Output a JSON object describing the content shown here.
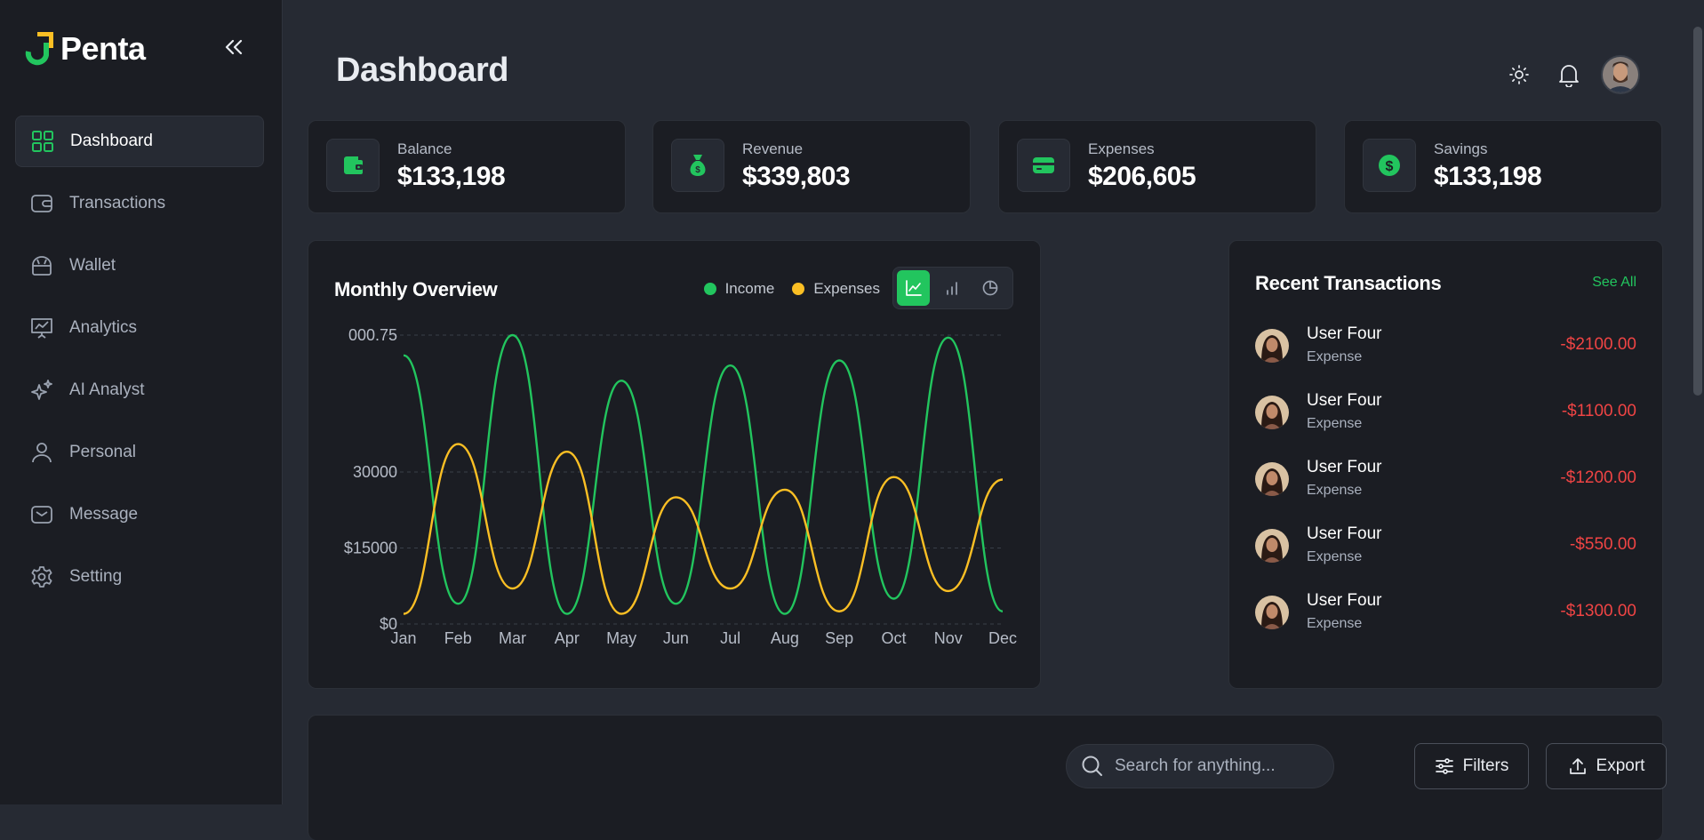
{
  "app": {
    "name": "Penta"
  },
  "colors": {
    "accent": "#22c55e",
    "income": "#22c55e",
    "expenses": "#fbbf24",
    "negative": "#ef4444",
    "background": "#262a33",
    "card": "#1b1d23"
  },
  "sidebar": {
    "collapse_icon": "double-chevron-left-icon",
    "items": [
      {
        "label": "Dashboard",
        "icon": "grid-icon",
        "active": true
      },
      {
        "label": "Transactions",
        "icon": "card-wallet-icon"
      },
      {
        "label": "Wallet",
        "icon": "wallet-bag-icon"
      },
      {
        "label": "Analytics",
        "icon": "presentation-chart-icon"
      },
      {
        "label": "AI Analyst",
        "icon": "sparkle-icon"
      },
      {
        "label": "Personal",
        "icon": "user-icon"
      },
      {
        "label": "Message",
        "icon": "mail-icon"
      },
      {
        "label": "Setting",
        "icon": "gear-icon"
      }
    ]
  },
  "header": {
    "title": "Dashboard",
    "icons": [
      "sun-icon",
      "bell-icon",
      "avatar"
    ]
  },
  "stats": [
    {
      "label": "Balance",
      "value": "$133,198",
      "icon": "wallet-icon"
    },
    {
      "label": "Revenue",
      "value": "$339,803",
      "icon": "money-bag-icon"
    },
    {
      "label": "Expenses",
      "value": "$206,605",
      "icon": "credit-card-icon"
    },
    {
      "label": "Savings",
      "value": "$133,198",
      "icon": "dollar-coin-icon"
    }
  ],
  "overview": {
    "title": "Monthly Overview",
    "legend": {
      "income": "Income",
      "expenses": "Expenses"
    },
    "chart_types": [
      "line-chart-icon",
      "bar-chart-icon",
      "pie-chart-icon"
    ],
    "active_chart_type": "line"
  },
  "chart_data": {
    "type": "line",
    "categories": [
      "Jan",
      "Feb",
      "Mar",
      "Apr",
      "May",
      "Jun",
      "Jul",
      "Aug",
      "Sep",
      "Oct",
      "Nov",
      "Dec"
    ],
    "y_tick_labels": [
      "$0",
      "$15000",
      "30000",
      "000.75"
    ],
    "y_ticks": [
      0,
      15000,
      30000,
      57000
    ],
    "ylim": [
      0,
      57000
    ],
    "grid": "horizontal dashed",
    "series": [
      {
        "name": "Income",
        "values": [
          53000,
          4000,
          57000,
          2000,
          48000,
          4000,
          51000,
          2000,
          52000,
          5000,
          56500,
          2500
        ]
      },
      {
        "name": "Expenses",
        "values": [
          2000,
          35500,
          7000,
          34000,
          2000,
          25000,
          7000,
          26500,
          2500,
          29000,
          6500,
          28500
        ]
      }
    ]
  },
  "transactions": {
    "title": "Recent Transactions",
    "see_all": "See All",
    "items": [
      {
        "name": "User Four",
        "type": "Expense",
        "amount": "-$2100.00"
      },
      {
        "name": "User Four",
        "type": "Expense",
        "amount": "-$1100.00"
      },
      {
        "name": "User Four",
        "type": "Expense",
        "amount": "-$1200.00"
      },
      {
        "name": "User Four",
        "type": "Expense",
        "amount": "-$550.00"
      },
      {
        "name": "User Four",
        "type": "Expense",
        "amount": "-$1300.00"
      }
    ]
  },
  "table_toolbar": {
    "search_placeholder": "Search for anything...",
    "filters_label": "Filters",
    "export_label": "Export"
  }
}
